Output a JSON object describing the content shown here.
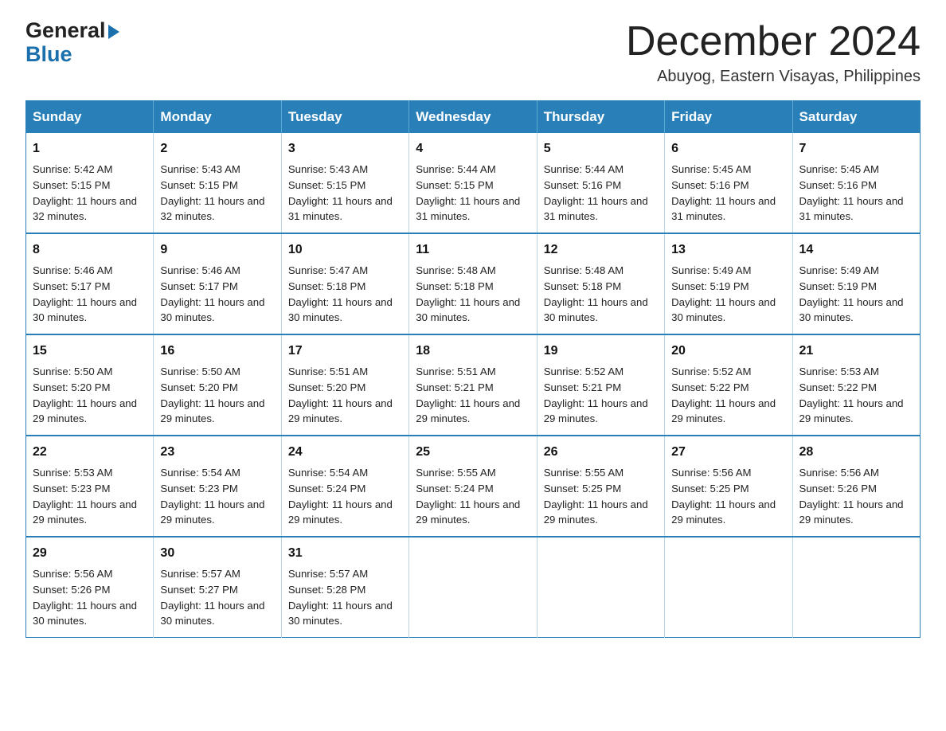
{
  "header": {
    "logo_line1": "General",
    "logo_line2": "Blue",
    "title": "December 2024",
    "subtitle": "Abuyog, Eastern Visayas, Philippines"
  },
  "calendar": {
    "days_of_week": [
      "Sunday",
      "Monday",
      "Tuesday",
      "Wednesday",
      "Thursday",
      "Friday",
      "Saturday"
    ],
    "weeks": [
      [
        {
          "day": "1",
          "sunrise": "Sunrise: 5:42 AM",
          "sunset": "Sunset: 5:15 PM",
          "daylight": "Daylight: 11 hours and 32 minutes."
        },
        {
          "day": "2",
          "sunrise": "Sunrise: 5:43 AM",
          "sunset": "Sunset: 5:15 PM",
          "daylight": "Daylight: 11 hours and 32 minutes."
        },
        {
          "day": "3",
          "sunrise": "Sunrise: 5:43 AM",
          "sunset": "Sunset: 5:15 PM",
          "daylight": "Daylight: 11 hours and 31 minutes."
        },
        {
          "day": "4",
          "sunrise": "Sunrise: 5:44 AM",
          "sunset": "Sunset: 5:15 PM",
          "daylight": "Daylight: 11 hours and 31 minutes."
        },
        {
          "day": "5",
          "sunrise": "Sunrise: 5:44 AM",
          "sunset": "Sunset: 5:16 PM",
          "daylight": "Daylight: 11 hours and 31 minutes."
        },
        {
          "day": "6",
          "sunrise": "Sunrise: 5:45 AM",
          "sunset": "Sunset: 5:16 PM",
          "daylight": "Daylight: 11 hours and 31 minutes."
        },
        {
          "day": "7",
          "sunrise": "Sunrise: 5:45 AM",
          "sunset": "Sunset: 5:16 PM",
          "daylight": "Daylight: 11 hours and 31 minutes."
        }
      ],
      [
        {
          "day": "8",
          "sunrise": "Sunrise: 5:46 AM",
          "sunset": "Sunset: 5:17 PM",
          "daylight": "Daylight: 11 hours and 30 minutes."
        },
        {
          "day": "9",
          "sunrise": "Sunrise: 5:46 AM",
          "sunset": "Sunset: 5:17 PM",
          "daylight": "Daylight: 11 hours and 30 minutes."
        },
        {
          "day": "10",
          "sunrise": "Sunrise: 5:47 AM",
          "sunset": "Sunset: 5:18 PM",
          "daylight": "Daylight: 11 hours and 30 minutes."
        },
        {
          "day": "11",
          "sunrise": "Sunrise: 5:48 AM",
          "sunset": "Sunset: 5:18 PM",
          "daylight": "Daylight: 11 hours and 30 minutes."
        },
        {
          "day": "12",
          "sunrise": "Sunrise: 5:48 AM",
          "sunset": "Sunset: 5:18 PM",
          "daylight": "Daylight: 11 hours and 30 minutes."
        },
        {
          "day": "13",
          "sunrise": "Sunrise: 5:49 AM",
          "sunset": "Sunset: 5:19 PM",
          "daylight": "Daylight: 11 hours and 30 minutes."
        },
        {
          "day": "14",
          "sunrise": "Sunrise: 5:49 AM",
          "sunset": "Sunset: 5:19 PM",
          "daylight": "Daylight: 11 hours and 30 minutes."
        }
      ],
      [
        {
          "day": "15",
          "sunrise": "Sunrise: 5:50 AM",
          "sunset": "Sunset: 5:20 PM",
          "daylight": "Daylight: 11 hours and 29 minutes."
        },
        {
          "day": "16",
          "sunrise": "Sunrise: 5:50 AM",
          "sunset": "Sunset: 5:20 PM",
          "daylight": "Daylight: 11 hours and 29 minutes."
        },
        {
          "day": "17",
          "sunrise": "Sunrise: 5:51 AM",
          "sunset": "Sunset: 5:20 PM",
          "daylight": "Daylight: 11 hours and 29 minutes."
        },
        {
          "day": "18",
          "sunrise": "Sunrise: 5:51 AM",
          "sunset": "Sunset: 5:21 PM",
          "daylight": "Daylight: 11 hours and 29 minutes."
        },
        {
          "day": "19",
          "sunrise": "Sunrise: 5:52 AM",
          "sunset": "Sunset: 5:21 PM",
          "daylight": "Daylight: 11 hours and 29 minutes."
        },
        {
          "day": "20",
          "sunrise": "Sunrise: 5:52 AM",
          "sunset": "Sunset: 5:22 PM",
          "daylight": "Daylight: 11 hours and 29 minutes."
        },
        {
          "day": "21",
          "sunrise": "Sunrise: 5:53 AM",
          "sunset": "Sunset: 5:22 PM",
          "daylight": "Daylight: 11 hours and 29 minutes."
        }
      ],
      [
        {
          "day": "22",
          "sunrise": "Sunrise: 5:53 AM",
          "sunset": "Sunset: 5:23 PM",
          "daylight": "Daylight: 11 hours and 29 minutes."
        },
        {
          "day": "23",
          "sunrise": "Sunrise: 5:54 AM",
          "sunset": "Sunset: 5:23 PM",
          "daylight": "Daylight: 11 hours and 29 minutes."
        },
        {
          "day": "24",
          "sunrise": "Sunrise: 5:54 AM",
          "sunset": "Sunset: 5:24 PM",
          "daylight": "Daylight: 11 hours and 29 minutes."
        },
        {
          "day": "25",
          "sunrise": "Sunrise: 5:55 AM",
          "sunset": "Sunset: 5:24 PM",
          "daylight": "Daylight: 11 hours and 29 minutes."
        },
        {
          "day": "26",
          "sunrise": "Sunrise: 5:55 AM",
          "sunset": "Sunset: 5:25 PM",
          "daylight": "Daylight: 11 hours and 29 minutes."
        },
        {
          "day": "27",
          "sunrise": "Sunrise: 5:56 AM",
          "sunset": "Sunset: 5:25 PM",
          "daylight": "Daylight: 11 hours and 29 minutes."
        },
        {
          "day": "28",
          "sunrise": "Sunrise: 5:56 AM",
          "sunset": "Sunset: 5:26 PM",
          "daylight": "Daylight: 11 hours and 29 minutes."
        }
      ],
      [
        {
          "day": "29",
          "sunrise": "Sunrise: 5:56 AM",
          "sunset": "Sunset: 5:26 PM",
          "daylight": "Daylight: 11 hours and 30 minutes."
        },
        {
          "day": "30",
          "sunrise": "Sunrise: 5:57 AM",
          "sunset": "Sunset: 5:27 PM",
          "daylight": "Daylight: 11 hours and 30 minutes."
        },
        {
          "day": "31",
          "sunrise": "Sunrise: 5:57 AM",
          "sunset": "Sunset: 5:28 PM",
          "daylight": "Daylight: 11 hours and 30 minutes."
        },
        null,
        null,
        null,
        null
      ]
    ]
  }
}
